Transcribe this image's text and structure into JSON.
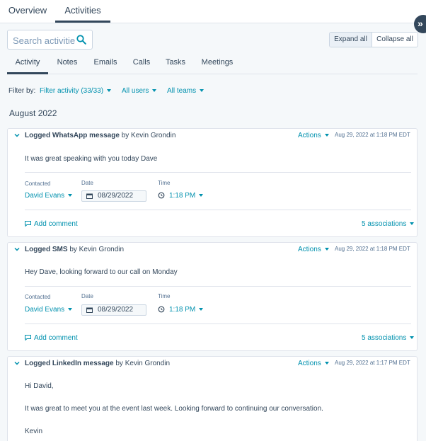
{
  "top_tabs": [
    {
      "label": "Overview"
    },
    {
      "label": "Activities"
    }
  ],
  "toolbar": {
    "search_placeholder": "Search activities",
    "expand_all": "Expand all",
    "collapse_all": "Collapse all"
  },
  "sub_tabs": [
    {
      "label": "Activity"
    },
    {
      "label": "Notes"
    },
    {
      "label": "Emails"
    },
    {
      "label": "Calls"
    },
    {
      "label": "Tasks"
    },
    {
      "label": "Meetings"
    }
  ],
  "filters": {
    "label": "Filter by:",
    "activity": "Filter activity (33/33)",
    "users": "All users",
    "teams": "All teams"
  },
  "month": "August 2022",
  "activities": [
    {
      "type": "Logged WhatsApp message",
      "by": "by Kevin Grondin",
      "actions": "Actions",
      "timestamp": "Aug 29, 2022 at 1:18 PM EDT",
      "body": "It was great speaking with you today Dave",
      "contacted_label": "Contacted",
      "contacted_value": "David Evans",
      "date_label": "Date",
      "date_value": "08/29/2022",
      "time_label": "Time",
      "time_value": "1:18 PM",
      "add_comment": "Add comment",
      "associations": "5 associations"
    },
    {
      "type": "Logged SMS",
      "by": "by Kevin Grondin",
      "actions": "Actions",
      "timestamp": "Aug 29, 2022 at 1:18 PM EDT",
      "body": "Hey Dave, looking forward to our call on Monday",
      "contacted_label": "Contacted",
      "contacted_value": "David Evans",
      "date_label": "Date",
      "date_value": "08/29/2022",
      "time_label": "Time",
      "time_value": "1:18 PM",
      "add_comment": "Add comment",
      "associations": "5 associations"
    },
    {
      "type": "Logged LinkedIn message",
      "by": "by Kevin Grondin",
      "actions": "Actions",
      "timestamp": "Aug 29, 2022 at 1:17 PM EDT",
      "body_lines": [
        "Hi David,",
        "It was great to meet you at the event last week. Looking forward to continuing our conversation.",
        "Kevin"
      ]
    }
  ]
}
